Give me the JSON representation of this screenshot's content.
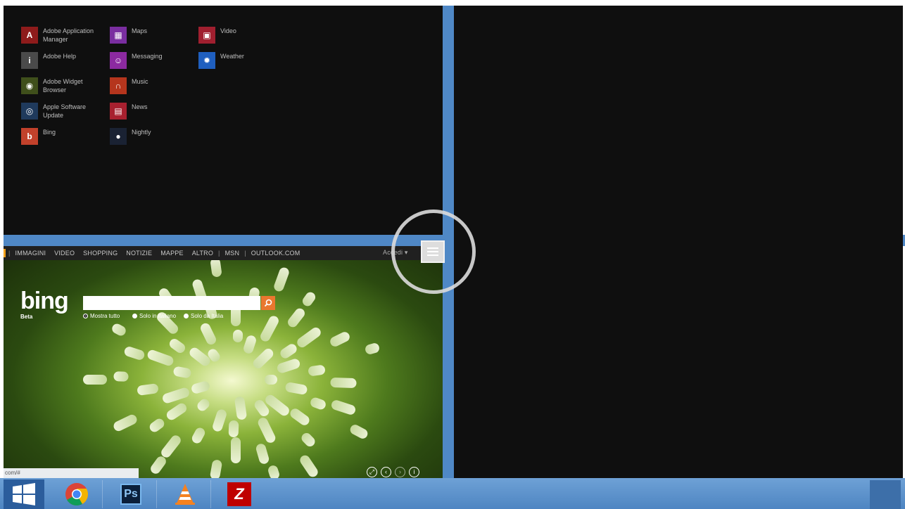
{
  "apps": {
    "columns": [
      [
        {
          "label": "Adobe Application Manager",
          "icon": "adobe-application-manager-icon",
          "color": "#8e1b1b",
          "glyph": "A"
        },
        {
          "label": "Adobe Help",
          "icon": "adobe-help-icon",
          "color": "#4a4a4a",
          "glyph": "i"
        },
        {
          "label": "Adobe Widget Browser",
          "icon": "adobe-widget-browser-icon",
          "color": "#3f4f1b",
          "glyph": "◉"
        },
        {
          "label": "Apple Software Update",
          "icon": "apple-software-update-icon",
          "color": "#1f3a5c",
          "glyph": "◎"
        },
        {
          "label": "Bing",
          "icon": "bing-icon",
          "color": "#c2412b",
          "glyph": "b"
        }
      ],
      [
        {
          "label": "Maps",
          "icon": "maps-icon",
          "color": "#7a2ea0",
          "glyph": "▦"
        },
        {
          "label": "Messaging",
          "icon": "messaging-icon",
          "color": "#8c2aa0",
          "glyph": "☺"
        },
        {
          "label": "Music",
          "icon": "music-icon",
          "color": "#b5351d",
          "glyph": "∩"
        },
        {
          "label": "News",
          "icon": "news-icon",
          "color": "#a8202f",
          "glyph": "▤"
        },
        {
          "label": "Nightly",
          "icon": "nightly-icon",
          "color": "#1a2233",
          "glyph": "●"
        }
      ],
      [
        {
          "label": "Video",
          "icon": "video-icon",
          "color": "#a01f2f",
          "glyph": "▣"
        },
        {
          "label": "Weather",
          "icon": "weather-icon",
          "color": "#1f5fbf",
          "glyph": "✹"
        }
      ]
    ]
  },
  "browser": {
    "nav": [
      "IMMAGINI",
      "VIDEO",
      "SHOPPING",
      "NOTIZIE",
      "MAPPE",
      "ALTRO",
      "|",
      "MSN",
      "|",
      "OUTLOOK.COM"
    ],
    "signin": "Accedi",
    "logo": "bing",
    "beta": "Beta",
    "search_placeholder": "",
    "radios": [
      {
        "label": "Mostra tutto",
        "selected": true
      },
      {
        "label": "Solo in italiano",
        "selected": false
      },
      {
        "label": "Solo da Italia",
        "selected": false
      }
    ],
    "status_url": "com/#",
    "controls": [
      "expand-icon",
      "previous-icon",
      "next-icon",
      "info-icon"
    ]
  },
  "taskbar": {
    "apps": [
      {
        "name": "chrome",
        "icon": "chrome-icon"
      },
      {
        "name": "photoshop",
        "icon": "photoshop-icon",
        "glyph": "Ps"
      },
      {
        "name": "vlc",
        "icon": "vlc-icon"
      },
      {
        "name": "filezilla",
        "icon": "filezilla-icon",
        "glyph": "Z"
      }
    ]
  },
  "colors": {
    "accent": "#4f88c6",
    "dark": "#0f0f0f",
    "search_button": "#e9772f"
  }
}
